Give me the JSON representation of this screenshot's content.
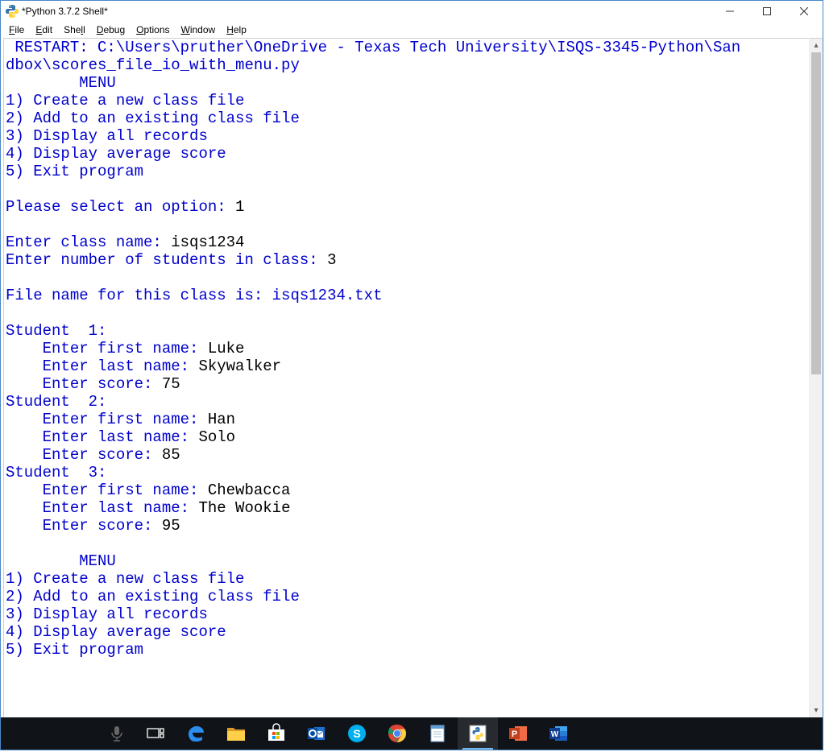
{
  "window": {
    "title": "*Python 3.7.2 Shell*"
  },
  "menubar": {
    "file": "File",
    "edit": "Edit",
    "shell": "Shell",
    "debug": "Debug",
    "options": "Options",
    "window": "Window",
    "help": "Help"
  },
  "shell": {
    "restart_line": " RESTART: C:\\Users\\pruther\\OneDrive - Texas Tech University\\ISQS-3345-Python\\San",
    "restart_line2": "dbox\\scores_file_io_with_menu.py",
    "menu_header": "        MENU",
    "opt1": "1) Create a new class file",
    "opt2": "2) Add to an existing class file",
    "opt3": "3) Display all records",
    "opt4": "4) Display average score",
    "opt5": "5) Exit program",
    "select_prompt": "Please select an option: ",
    "select_val": "1",
    "class_prompt": "Enter class name: ",
    "class_val": "isqs1234",
    "numstu_prompt": "Enter number of students in class: ",
    "numstu_val": "3",
    "filemsg": "File name for this class is: isqs1234.txt",
    "students": [
      {
        "hdr": "Student  1:",
        "fn_prompt": "    Enter first name: ",
        "fn": "Luke",
        "ln_prompt": "    Enter last name: ",
        "ln": "Skywalker",
        "sc_prompt": "    Enter score: ",
        "sc": "75"
      },
      {
        "hdr": "Student  2:",
        "fn_prompt": "    Enter first name: ",
        "fn": "Han",
        "ln_prompt": "    Enter last name: ",
        "ln": "Solo",
        "sc_prompt": "    Enter score: ",
        "sc": "85"
      },
      {
        "hdr": "Student  3:",
        "fn_prompt": "    Enter first name: ",
        "fn": "Chewbacca",
        "ln_prompt": "    Enter last name: ",
        "ln": "The Wookie",
        "sc_prompt": "    Enter score: ",
        "sc": "95"
      }
    ]
  },
  "taskbar": {
    "cortana": "cortana",
    "taskview": "task-view",
    "edge": "edge",
    "explorer": "file-explorer",
    "store": "store",
    "outlook": "outlook",
    "skype": "skype",
    "chrome": "chrome",
    "notepad": "notepad",
    "idle": "idle",
    "ppt": "powerpoint",
    "word": "word"
  }
}
